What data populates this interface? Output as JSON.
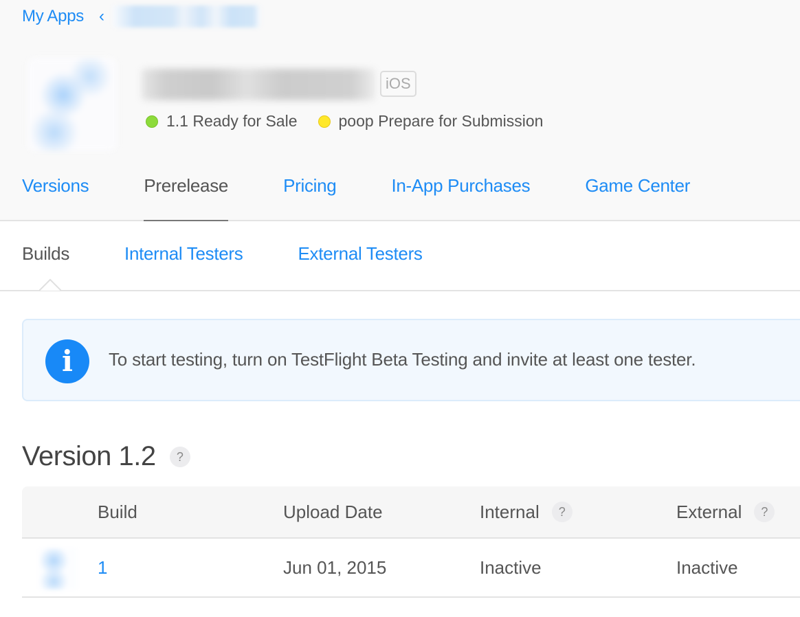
{
  "breadcrumb": {
    "root_label": "My Apps",
    "separator_icon": "chevron-left-icon",
    "current_label_redacted": true
  },
  "app": {
    "name_redacted": true,
    "platform_badge": "iOS",
    "statuses": [
      {
        "color": "#8ddb3b",
        "label": "1.1 Ready for Sale"
      },
      {
        "color": "#ffe82a",
        "label": "poop Prepare for Submission"
      }
    ]
  },
  "main_tabs": [
    {
      "label": "Versions",
      "active": false
    },
    {
      "label": "Prerelease",
      "active": true
    },
    {
      "label": "Pricing",
      "active": false
    },
    {
      "label": "In-App Purchases",
      "active": false
    },
    {
      "label": "Game Center",
      "active": false
    }
  ],
  "sub_tabs": [
    {
      "label": "Builds",
      "active": true
    },
    {
      "label": "Internal Testers",
      "active": false
    },
    {
      "label": "External Testers",
      "active": false
    }
  ],
  "info_banner": {
    "icon": "info-icon",
    "icon_glyph": "i",
    "text": "To start testing, turn on TestFlight Beta Testing and invite at least one tester."
  },
  "version_section": {
    "title": "Version 1.2",
    "help_glyph": "?"
  },
  "builds_table": {
    "columns": [
      {
        "label": "Build",
        "help": false
      },
      {
        "label": "Upload Date",
        "help": false
      },
      {
        "label": "Internal",
        "help": true
      },
      {
        "label": "External",
        "help": true
      }
    ],
    "help_glyph": "?",
    "rows": [
      {
        "build": "1",
        "upload_date": "Jun 01, 2015",
        "internal": "Inactive",
        "external": "Inactive"
      }
    ]
  },
  "colors": {
    "accent": "#1e8cf5",
    "info_blue": "#1889f7",
    "text": "#555555"
  }
}
